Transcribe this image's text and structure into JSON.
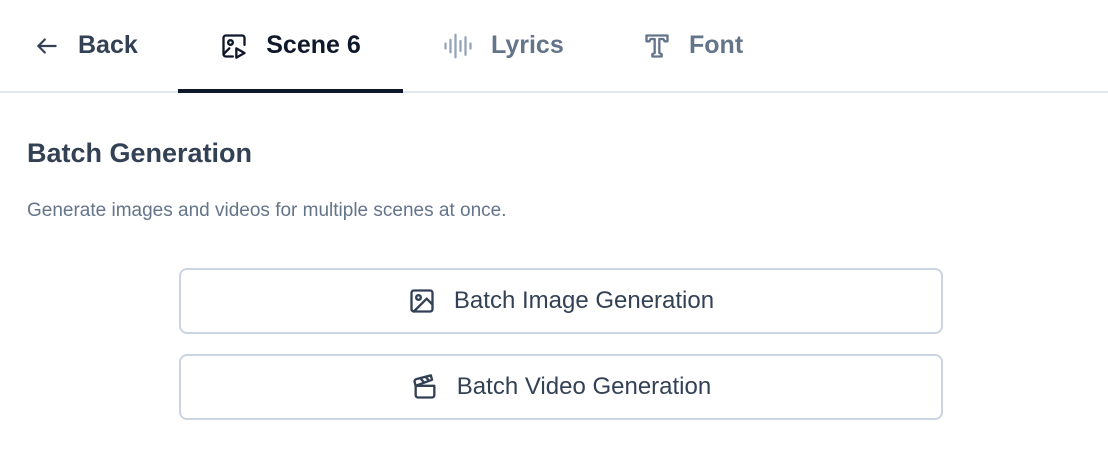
{
  "tabs": {
    "back": "Back",
    "scene": "Scene 6",
    "lyrics": "Lyrics",
    "font": "Font"
  },
  "section": {
    "title": "Batch Generation",
    "description": "Generate images and videos for multiple scenes at once.",
    "image_button": "Batch Image Generation",
    "video_button": "Batch Video Generation"
  }
}
